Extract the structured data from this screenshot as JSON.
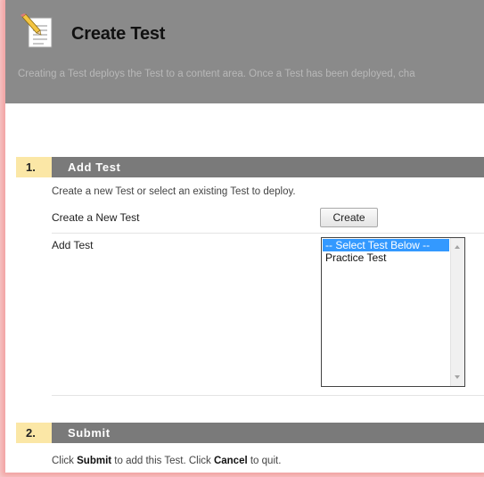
{
  "header": {
    "title": "Create Test",
    "description": "Creating a Test deploys the Test to a content area. Once a Test has been deployed, cha",
    "icon": "document-pencil-icon"
  },
  "step1": {
    "number": "1.",
    "title": "Add Test",
    "instructions": "Create a new Test or select an existing Test to deploy.",
    "create_label": "Create a New Test",
    "create_button": "Create",
    "add_label": "Add Test",
    "list_options": [
      "-- Select Test Below --",
      "Practice Test"
    ],
    "selected_option": "-- Select Test Below --"
  },
  "step2": {
    "number": "2.",
    "title": "Submit",
    "instructions_part1": "Click ",
    "instructions_submit": "Submit",
    "instructions_part2": " to add this Test. Click ",
    "instructions_cancel": "Cancel",
    "instructions_part3": " to quit."
  },
  "colors": {
    "header_bg": "#8a8a8a",
    "step_bar_bg": "#7a7a7a",
    "step_number_bg": "#fbe7a6",
    "selection_bg": "#3399ff",
    "frame_glow": "#f2a3a3"
  }
}
